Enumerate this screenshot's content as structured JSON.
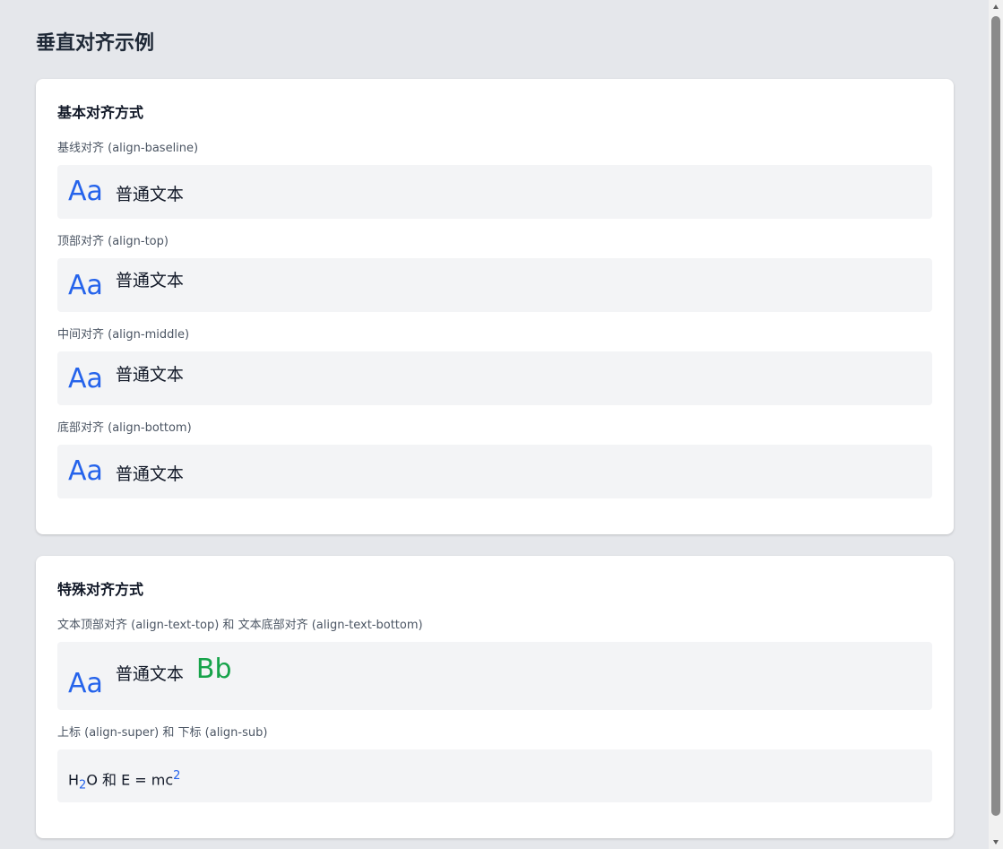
{
  "page": {
    "title": "垂直对齐示例"
  },
  "basic": {
    "title": "基本对齐方式",
    "items": [
      {
        "label": "基线对齐 (align-baseline)",
        "sample_big": "Aa",
        "sample_text": "普通文本"
      },
      {
        "label": "顶部对齐 (align-top)",
        "sample_big": "Aa",
        "sample_text": "普通文本"
      },
      {
        "label": "中间对齐 (align-middle)",
        "sample_big": "Aa",
        "sample_text": "普通文本"
      },
      {
        "label": "底部对齐 (align-bottom)",
        "sample_big": "Aa",
        "sample_text": "普通文本"
      }
    ]
  },
  "special": {
    "title": "特殊对齐方式",
    "text_align": {
      "label": "文本顶部对齐 (align-text-top) 和 文本底部对齐 (align-text-bottom)",
      "sample_big": "Aa",
      "sample_text": "普通文本",
      "sample_green": "Bb"
    },
    "super_sub": {
      "label": "上标 (align-super) 和 下标 (align-sub)",
      "h": "H",
      "sub": "2",
      "o_and": "O 和 E = mc",
      "sup": "2"
    }
  },
  "colors": {
    "accent_blue": "#2563eb",
    "accent_green": "#16a34a",
    "page_bg": "#e5e7eb",
    "demo_bg": "#f3f4f6"
  },
  "icons": {
    "scroll_up": "triangle-up",
    "scroll_down": "triangle-down"
  }
}
